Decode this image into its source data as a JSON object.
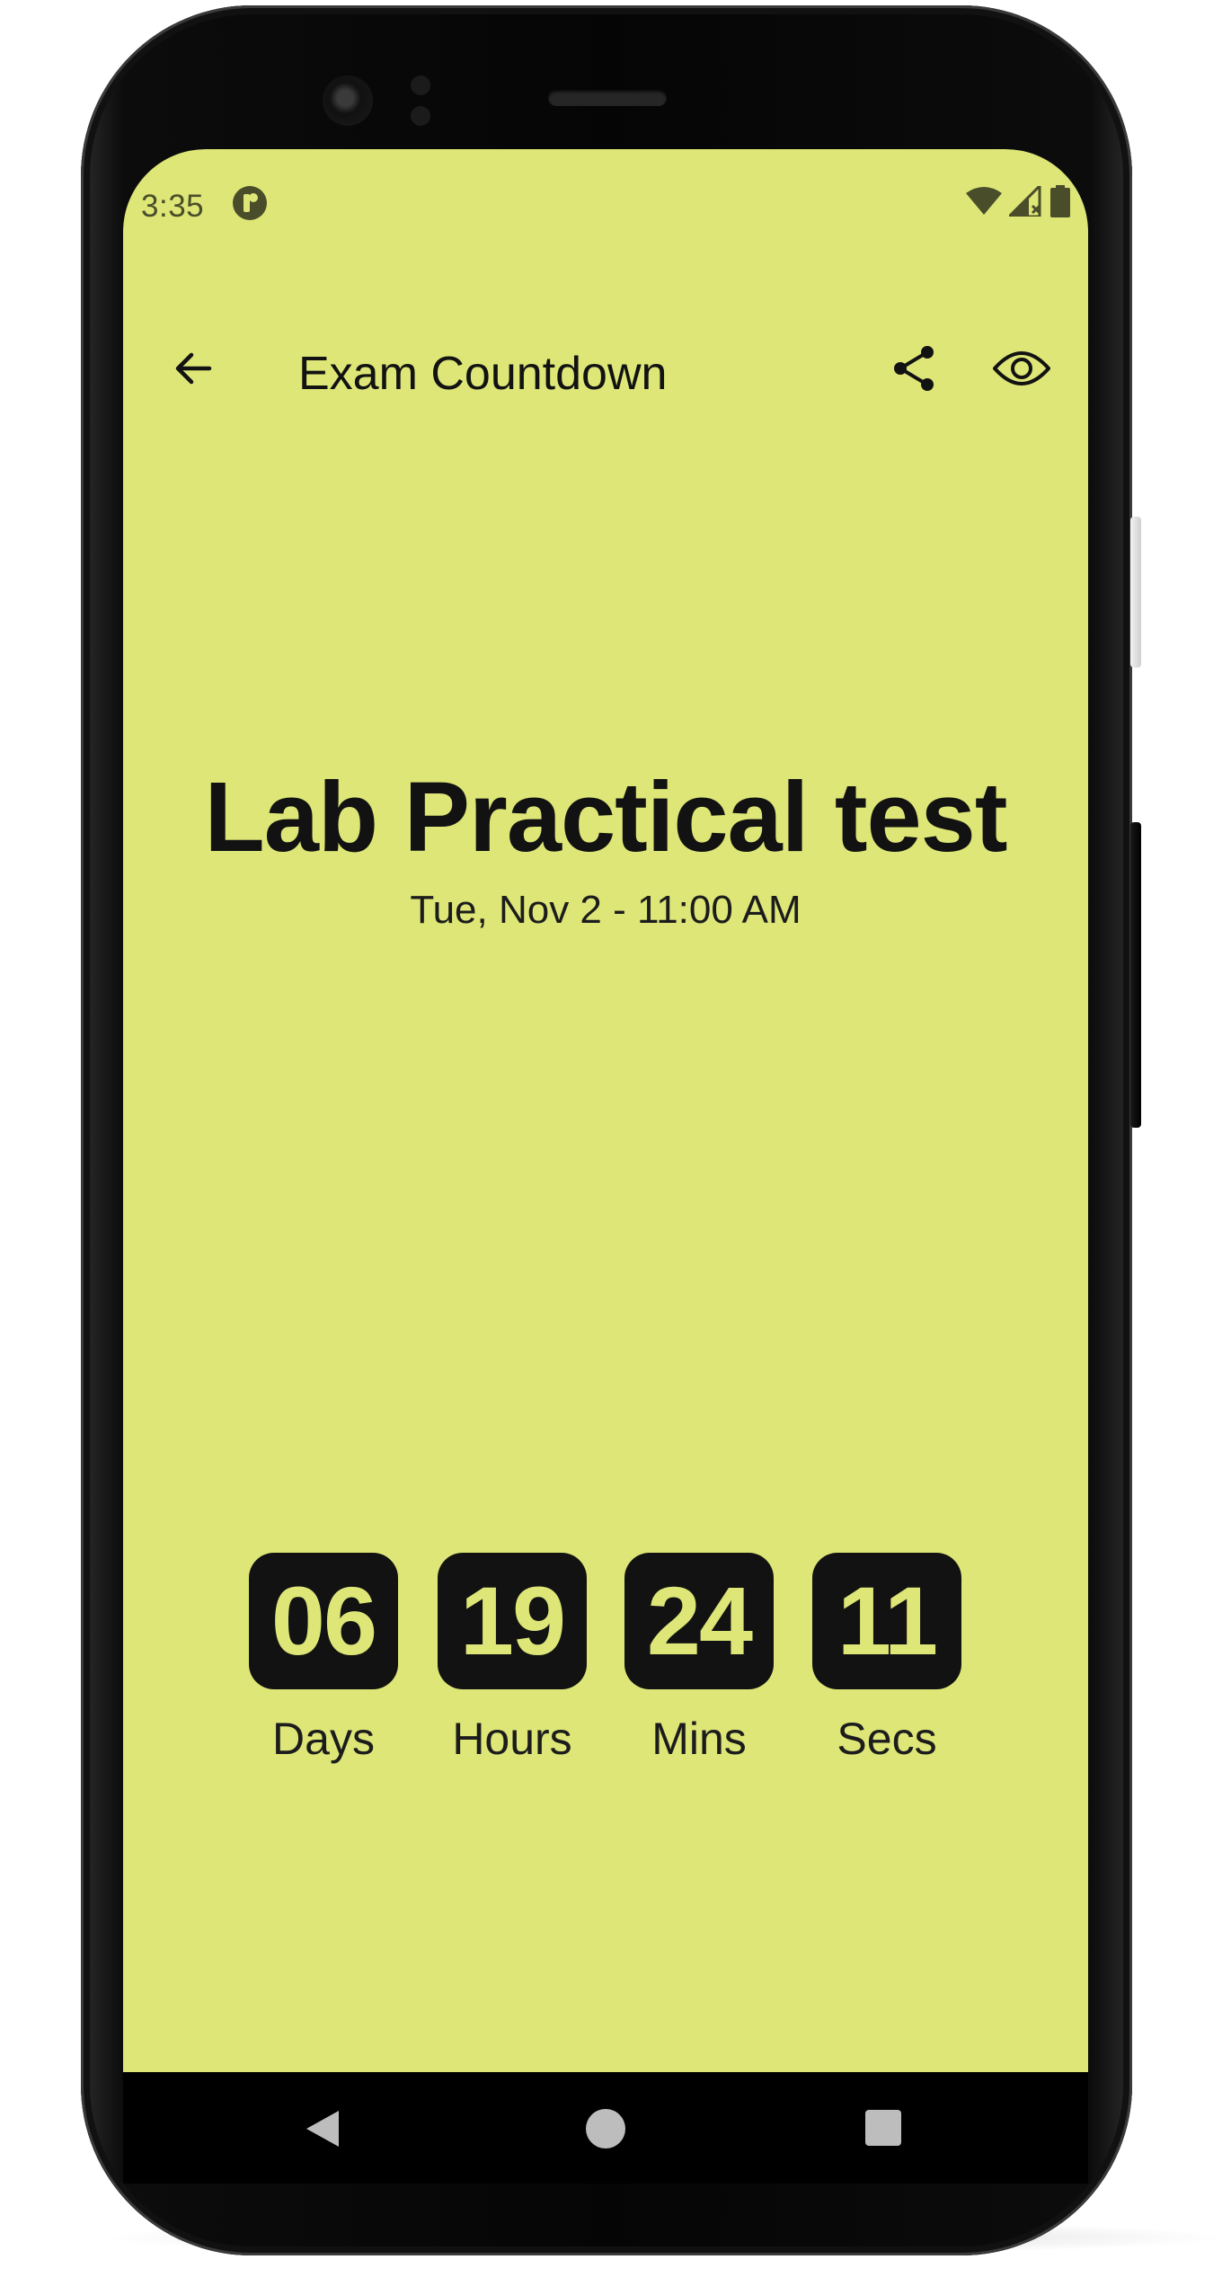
{
  "status_bar": {
    "time": "3:35",
    "app_icon": "app-notification-icon",
    "wifi_icon": "wifi-icon",
    "signal_icon": "cell-signal-icon",
    "battery_icon": "battery-icon"
  },
  "app_bar": {
    "title": "Exam Countdown",
    "back_icon": "arrow-back-icon",
    "share_icon": "share-icon",
    "view_icon": "eye-icon"
  },
  "exam": {
    "name": "Lab Practical test",
    "datetime": "Tue, Nov 2 - 11:00 AM"
  },
  "countdown": {
    "days": {
      "value": "06",
      "label": "Days"
    },
    "hours": {
      "value": "19",
      "label": "Hours"
    },
    "mins": {
      "value": "24",
      "label": "Mins"
    },
    "secs": {
      "value": "11",
      "label": "Secs"
    }
  },
  "nav_bar": {
    "back_icon": "nav-back-icon",
    "home_icon": "nav-home-icon",
    "recents_icon": "nav-recents-icon"
  },
  "colors": {
    "screen_background": "#dde677",
    "text_primary": "#121212",
    "digit_box": "#121212",
    "digit_text": "#dde677"
  }
}
